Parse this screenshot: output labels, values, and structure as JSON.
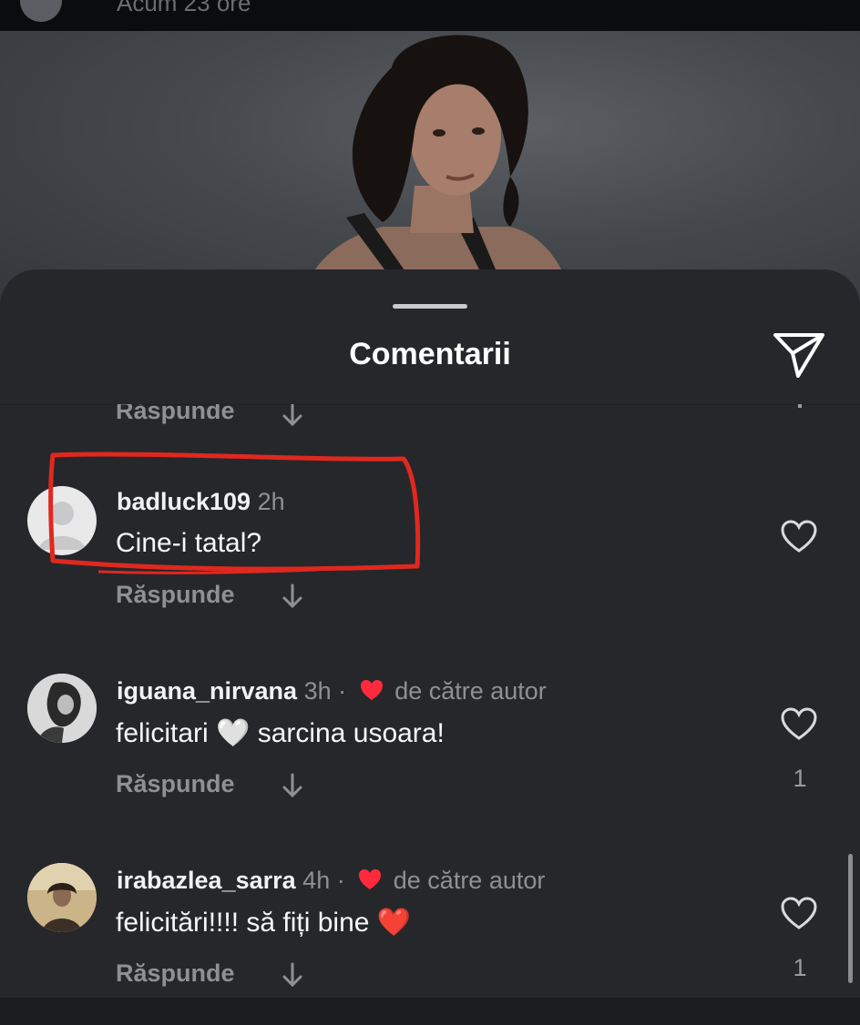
{
  "top": {
    "subtitle": "Acum 23 ore"
  },
  "sheet": {
    "title": "Comentarii",
    "share_icon": "send-icon"
  },
  "partial_comment": {
    "reply_label": "Răspunde"
  },
  "comments": [
    {
      "username": "badluck109",
      "time": "2h",
      "text": "Cine-i tatal?",
      "reply_label": "Răspunde",
      "liked_by_author": false,
      "likes": ""
    },
    {
      "username": "iguana_nirvana",
      "time": "3h",
      "separator": "·",
      "author_note": "de către autor",
      "text": "felicitari 🤍 sarcina usoara!",
      "reply_label": "Răspunde",
      "liked_by_author": true,
      "likes": "1"
    },
    {
      "username": "irabazlea_sarra",
      "time": "4h",
      "separator": "·",
      "author_note": "de către autor",
      "text": "felicitări!!!! să fiți bine ❤️",
      "reply_label": "Răspunde",
      "liked_by_author": true,
      "likes": "1"
    }
  ],
  "colors": {
    "highlight_annotation": "#e0281f",
    "heart": "#ff2a3c"
  }
}
